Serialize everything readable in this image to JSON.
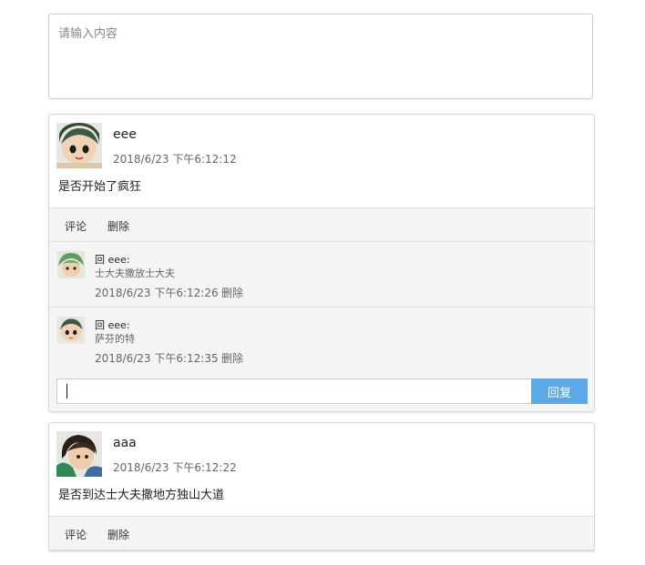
{
  "composer": {
    "placeholder": "请输入内容"
  },
  "posts": [
    {
      "author": "eee",
      "time": "2018/6/23 下午6:12:12",
      "content": "是否开始了疯狂",
      "actions": {
        "comment": "评论",
        "delete": "删除"
      },
      "replies": [
        {
          "reply_to": "回 eee:",
          "text": "士大夫撒放士大夫",
          "time": "2018/6/23 下午6:12:26",
          "delete": "删除"
        },
        {
          "reply_to": "回 eee:",
          "text": "萨芬的特",
          "time": "2018/6/23 下午6:12:35",
          "delete": "删除"
        }
      ],
      "reply_input": {
        "value": "",
        "button": "回复"
      }
    },
    {
      "author": "aaa",
      "time": "2018/6/23 下午6:12:22",
      "content": "是否到达士大夫撒地方独山大道",
      "actions": {
        "comment": "评论",
        "delete": "删除"
      }
    }
  ],
  "colors": {
    "reply_button": "#5ba9e6",
    "actions_bg": "#f4f4f4"
  },
  "icons": {
    "avatar_1": "avatar-cartoon-boy",
    "avatar_2": "avatar-cartoon-warrior",
    "avatar_reply_1": "avatar-cartoon-green"
  }
}
